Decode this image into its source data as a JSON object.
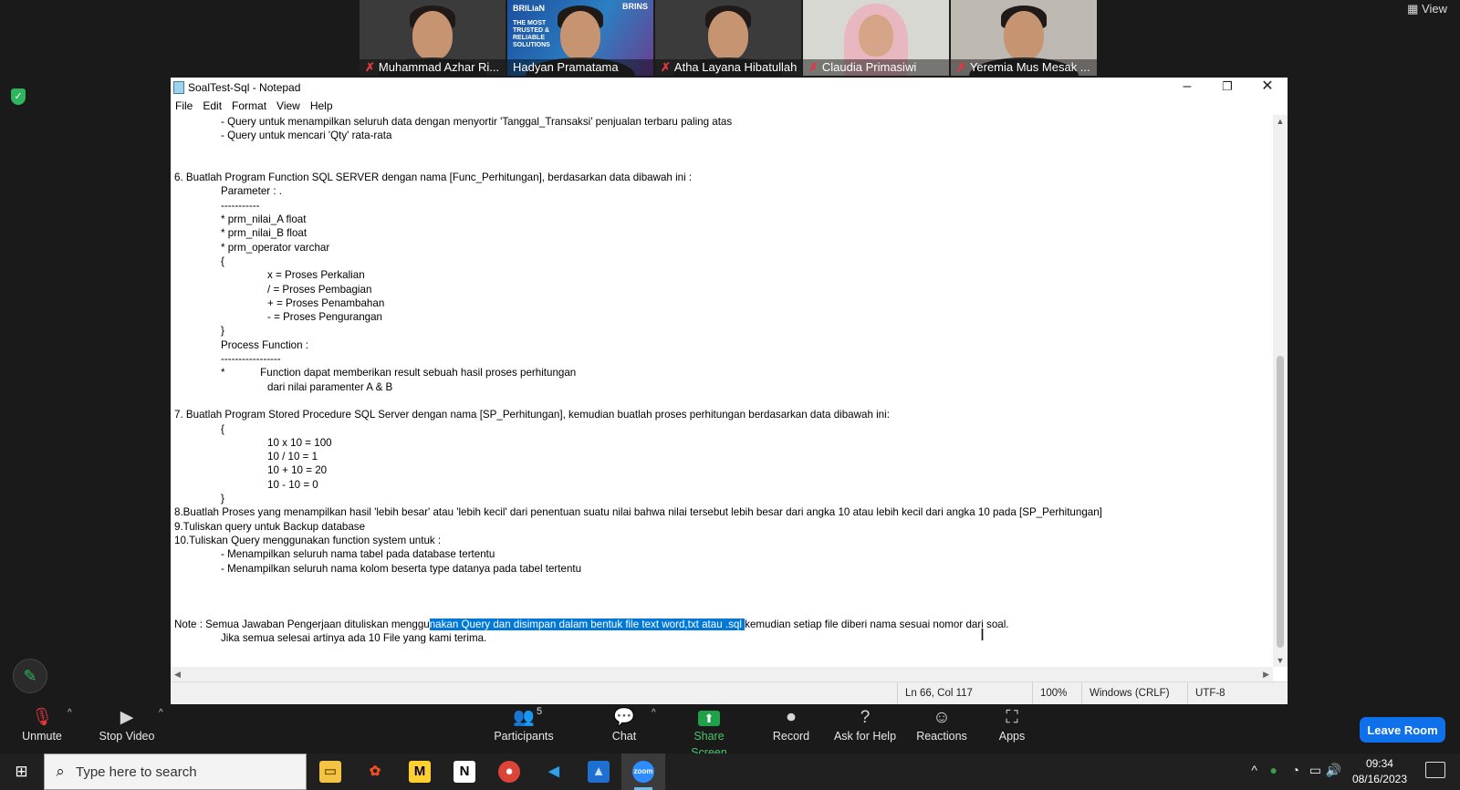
{
  "meeting": {
    "view_label": "View",
    "participants_tiles": [
      {
        "name": "Muhammad Azhar Ri...",
        "muted": true
      },
      {
        "name": "Hadyan Pramatama",
        "muted": false,
        "active": true,
        "brand_left": "BRILiaN",
        "brand_right": "BRINS",
        "brand_text": "THE MOST TRUSTED & RELIABLE SOLUTIONS"
      },
      {
        "name": "Atha Layana Hibatullah",
        "muted": true
      },
      {
        "name": "Claudia Primasiwi",
        "muted": true
      },
      {
        "name": "Yeremia Mus Mesak ...",
        "muted": true
      }
    ]
  },
  "notepad": {
    "title": "SoalTest-Sql - Notepad",
    "menu": [
      "File",
      "Edit",
      "Format",
      "View",
      "Help"
    ],
    "lines": [
      {
        "indent": 1,
        "text": "- Query untuk menampilkan seluruh data dengan menyortir 'Tanggal_Transaksi' penjualan terbaru paling atas"
      },
      {
        "indent": 1,
        "text": "- Query untuk mencari 'Qty' rata-rata"
      },
      {
        "indent": 0,
        "text": ""
      },
      {
        "indent": 0,
        "text": ""
      },
      {
        "indent": 0,
        "text": "6. Buatlah Program Function SQL SERVER dengan nama [Func_Perhitungan], berdasarkan data dibawah ini :"
      },
      {
        "indent": 1,
        "text": "Parameter : ."
      },
      {
        "indent": 1,
        "text": "-----------"
      },
      {
        "indent": 1,
        "text": "* prm_nilai_A float"
      },
      {
        "indent": 1,
        "text": "* prm_nilai_B float"
      },
      {
        "indent": 1,
        "text": "* prm_operator varchar"
      },
      {
        "indent": 1,
        "text": "{"
      },
      {
        "indent": 2,
        "text": "x = Proses Perkalian"
      },
      {
        "indent": 2,
        "text": "/ = Proses Pembagian"
      },
      {
        "indent": 2,
        "text": "+ = Proses Penambahan"
      },
      {
        "indent": 2,
        "text": "- = Proses Pengurangan"
      },
      {
        "indent": 1,
        "text": "}"
      },
      {
        "indent": 1,
        "text": "Process Function :"
      },
      {
        "indent": 1,
        "text": "-----------------"
      },
      {
        "indent": 1,
        "text": "*            Function dapat memberikan result sebuah hasil proses perhitungan"
      },
      {
        "indent": 2,
        "text": "dari nilai paramenter A & B"
      },
      {
        "indent": 0,
        "text": ""
      },
      {
        "indent": 0,
        "text": "7. Buatlah Program Stored Procedure SQL Server dengan nama [SP_Perhitungan], kemudian buatlah proses perhitungan berdasarkan data dibawah ini:"
      },
      {
        "indent": 1,
        "text": "{"
      },
      {
        "indent": 2,
        "text": "10 x 10 = 100"
      },
      {
        "indent": 2,
        "text": "10 / 10 = 1"
      },
      {
        "indent": 2,
        "text": "10 + 10 = 20"
      },
      {
        "indent": 2,
        "text": "10 - 10 = 0"
      },
      {
        "indent": 1,
        "text": "}"
      },
      {
        "indent": 0,
        "text": "8.Buatlah Proses yang menampilkan hasil 'lebih besar' atau 'lebih kecil' dari penentuan suatu nilai bahwa nilai tersebut lebih besar dari angka 10 atau lebih kecil dari angka 10 pada [SP_Perhitungan]"
      },
      {
        "indent": 0,
        "text": "9.Tuliskan query untuk Backup database"
      },
      {
        "indent": 0,
        "text": "10.Tuliskan Query menggunakan function system untuk :"
      },
      {
        "indent": 1,
        "text": "- Menampilkan seluruh nama tabel pada database tertentu"
      },
      {
        "indent": 1,
        "text": "- Menampilkan seluruh nama kolom beserta type datanya pada tabel tertentu"
      },
      {
        "indent": 0,
        "text": ""
      },
      {
        "indent": 0,
        "text": ""
      },
      {
        "indent": 0,
        "text": ""
      }
    ],
    "note_before": "Note : Semua Jawaban Pengerjaan dituliskan menggu",
    "note_selected": "nakan Query dan disimpan dalam bentuk file text word,txt atau .sql ",
    "note_after": "kemudian setiap file diberi nama sesuai nomor dari soal.",
    "note_line2": "Jika semua selesai artinya ada 10 File yang kami terima.",
    "status": {
      "position": "Ln 66, Col 117",
      "zoom": "100%",
      "line_ending": "Windows (CRLF)",
      "encoding": "UTF-8"
    }
  },
  "controls": {
    "unmute": "Unmute",
    "stop_video": "Stop Video",
    "participants": "Participants",
    "participants_count": "5",
    "chat": "Chat",
    "share_screen": "Share Screen",
    "record": "Record",
    "ask_help": "Ask for Help",
    "reactions": "Reactions",
    "apps": "Apps",
    "leave": "Leave Room"
  },
  "taskbar": {
    "search_placeholder": "Type here to search",
    "time": "09:34",
    "date": "08/16/2023"
  },
  "colors": {
    "selection": "#0078d7",
    "share_green": "#1fa149",
    "leave_blue": "#0e71eb",
    "active_speaker": "#f5d400"
  }
}
